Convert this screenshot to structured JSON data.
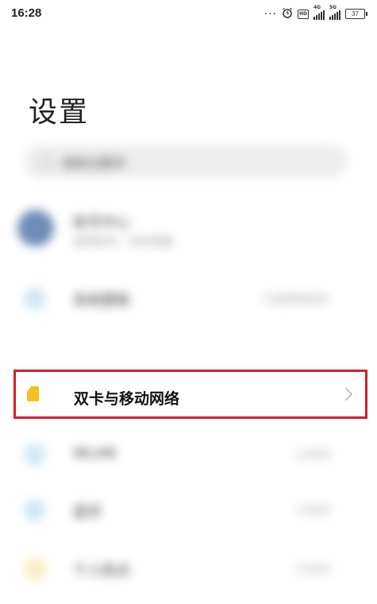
{
  "status_bar": {
    "time": "16:28",
    "network_1": "4G",
    "network_2": "5G",
    "hd_label": "HD",
    "battery": "37",
    "dots": "···"
  },
  "page": {
    "title": "设置"
  },
  "search": {
    "placeholder": "搜索设置项"
  },
  "account": {
    "name": "账号中心",
    "subtitle": "登录账号，同步数据"
  },
  "blurred_items": [
    {
      "label": "系统更新",
      "value": "已是最新版本",
      "icon_color": "#cfe7f5"
    },
    {
      "label": "WLAN",
      "value": "已关闭",
      "icon_color": "#cfe9f7"
    },
    {
      "label": "蓝牙",
      "value": "已关闭",
      "icon_color": "#cde8f6"
    },
    {
      "label": "个人热点",
      "value": "已关闭",
      "icon_color": "#fbecc2"
    }
  ],
  "highlighted_item": {
    "label": "双卡与移动网络",
    "icon_color": "#f4c020",
    "highlight_color": "#d0212b"
  }
}
